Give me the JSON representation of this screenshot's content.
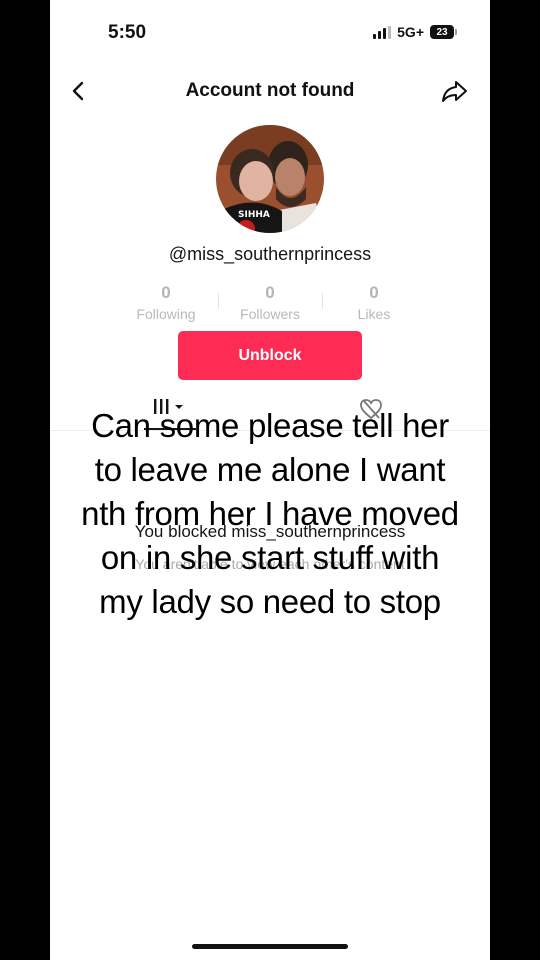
{
  "status_bar": {
    "time": "5:50",
    "network": "5G+",
    "battery": "23"
  },
  "header": {
    "title": "Account not found",
    "back_icon": "chevron-left-icon",
    "share_icon": "share-arrow-icon"
  },
  "profile": {
    "username": "@miss_southernprincess",
    "stats": [
      {
        "value": "0",
        "label": "Following"
      },
      {
        "value": "0",
        "label": "Followers"
      },
      {
        "value": "0",
        "label": "Likes"
      }
    ],
    "unblock_label": "Unblock"
  },
  "tabs": {
    "videos_icon": "grid-icon",
    "liked_icon": "hidden-heart-icon"
  },
  "blocked": {
    "title": "You blocked miss_southernprincess",
    "subtitle": "You aren't able to view each other's content"
  },
  "overlay": {
    "lines": [
      "Can some please tell her",
      "to leave me alone I want",
      "nth from her I have moved",
      "on in she start stuff with",
      "my lady so need to stop"
    ]
  },
  "colors": {
    "accent": "#fe2c55",
    "background": "#ffffff",
    "frame": "#000000"
  }
}
